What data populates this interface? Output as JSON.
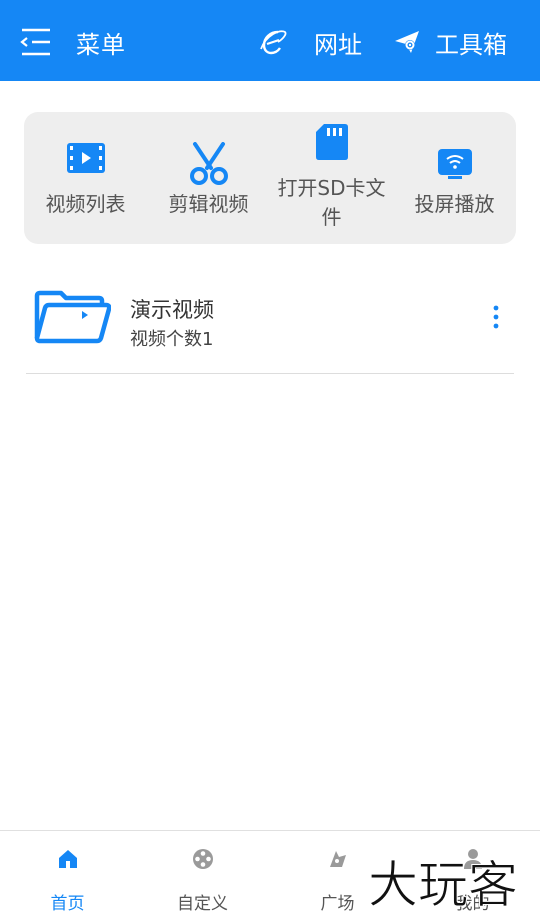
{
  "header": {
    "menu_label": "菜单",
    "url_label": "网址",
    "tools_label": "工具箱",
    "bg_color": "#1587f5"
  },
  "quick_actions": [
    {
      "label": "视频列表",
      "icon": "video-list-icon"
    },
    {
      "label": "剪辑视频",
      "icon": "scissors-icon"
    },
    {
      "label": "打开SD卡文件",
      "icon": "sd-card-icon"
    },
    {
      "label": "投屏播放",
      "icon": "cast-screen-icon"
    }
  ],
  "list": [
    {
      "title": "演示视频",
      "subtitle": "视频个数1",
      "icon": "folder-icon"
    }
  ],
  "bottom_nav": [
    {
      "label": "首页",
      "icon": "home-icon",
      "active": true
    },
    {
      "label": "自定义",
      "icon": "film-reel-icon",
      "active": false
    },
    {
      "label": "广场",
      "icon": "plaza-icon",
      "active": false
    },
    {
      "label": "我的",
      "icon": "user-icon",
      "active": false
    }
  ],
  "watermark": "大玩客",
  "accent_color": "#1587f5"
}
